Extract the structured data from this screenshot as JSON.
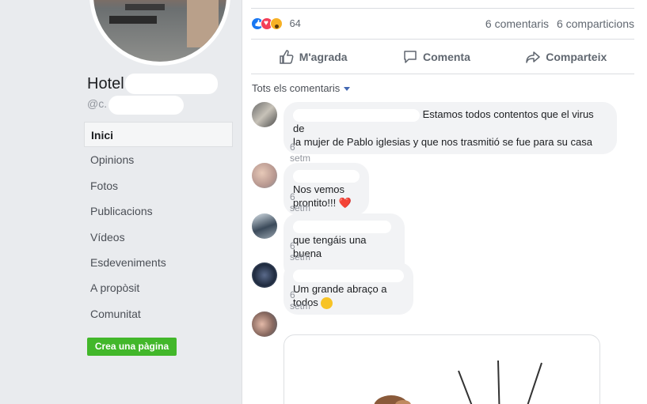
{
  "page": {
    "name_prefix": "Hotel",
    "handle_prefix": "@c."
  },
  "nav": {
    "items": [
      "Inici",
      "Opinions",
      "Fotos",
      "Publicacions",
      "Vídeos",
      "Esdeveniments",
      "A propòsit",
      "Comunitat"
    ],
    "active_index": 0
  },
  "create_page_button": "Crea una pàgina",
  "post": {
    "reaction_count": "64",
    "reactions": [
      "like-icon",
      "love-icon",
      "wow-icon"
    ],
    "comments_count": "6 comentaris",
    "shares_count": "6 comparticions",
    "actions": {
      "like": "M'agrada",
      "comment": "Comenta",
      "share": "Comparteix"
    },
    "filter_label": "Tots els comentaris"
  },
  "comments": [
    {
      "text_line1": "Estamos todos contentos que el virus de",
      "text_line2": "la mujer de Pablo iglesias y que nos trasmitió se fue para su casa",
      "time": "6 setm"
    },
    {
      "text": "Nos vemos prontito!!!",
      "emoji": "❤️",
      "time": "6 setm"
    },
    {
      "text": "que tengáis una buena temporada.saludos...!!",
      "time": "6 setm"
    },
    {
      "text": "Um grande abraço a todos",
      "emoji": "smile-emoji",
      "time": "6 setm"
    }
  ],
  "colors": {
    "accent_green": "#42b72a",
    "like_blue": "#1877f2",
    "love_red": "#f33e58",
    "wow_yellow": "#f7b125"
  }
}
